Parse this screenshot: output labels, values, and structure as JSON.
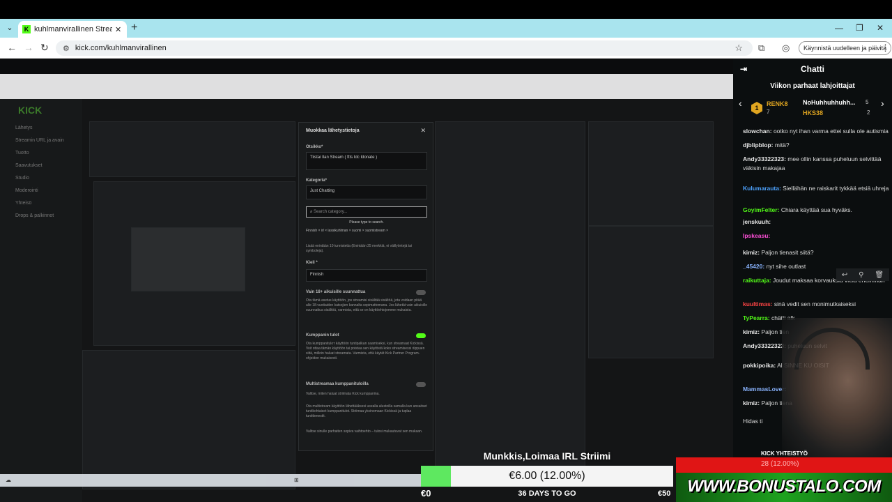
{
  "browser": {
    "tab_title": "kuhlmanvirallinen Stream - Wa",
    "url": "kick.com/kuhlmanvirallinen",
    "restart_label": "Käynnistä uudelleen ja päivitä"
  },
  "modal": {
    "title": "Muokkaa lähetystietoja",
    "title_label": "Otsikko*",
    "title_value": "Tiistai Ilan Stream ( ftts Idc Idonate )",
    "category_label": "Kategoria*",
    "category_value": "Just Chatting",
    "search_placeholder": "Search category...",
    "search_hint": "Please type to search.",
    "tags": [
      "Finnish ×",
      "irl ×",
      "lassikuhlman ×",
      "suomi ×",
      "suomistream ×"
    ],
    "tags_hint": "Lisää enintään 10 tunnistetta (Enintään 25 merkkiä, ei välilyöntejä tai symboleja).",
    "language_label": "Kieli *",
    "language_value": "Finnish",
    "adult_label": "Vain 18+ aikuisille suunnattua",
    "adult_text": "Ota tämä asetus käyttöön, jos streamisi sisältää sisältöä, jota voidaan pitää alle 18-vuotiaiden katsojien kannalta sopimattomana. Jos lähetät vain aikuisille suunnattua sisältöä, varmista, että se on käyttöehtojemme mukaista.",
    "partner_label": "Kumppanin tulot",
    "partner_text": "Ota kumppanituloт käyttöön tuntipalkan saamiseksi, kun streamaat Kickissä. Voit ottaa tämän käyttöön tai poistaa sen käytöstä koko streamisessi riippuen siitä, milloin haluat streamata. Varmista, että käytät Kick Partner Program-ohjeiden mukaisesti.",
    "multi_label": "Multistreamaa kumppanituloilla",
    "multi_text": "Valitse, miten haluat striimata Kick kumppanina.",
    "multi_text2": "Ota multistream käyttöön lähettääksesi usealla alustoilla samalla kun ansaitset tuntikohtaiset kumppanitulot. Striimaa yksinomaan Kickissä ja tuplaa tuntitienestit.",
    "multi_text3": "Valitse sinulle parhaiten sopiva vaihtoehto – tulosi mukautuvat sen mukaan."
  },
  "chat": {
    "header": "Chatti",
    "top_gifters_label": "Viikon parhaat lahjoittajat",
    "gifters": [
      {
        "name": "RENK8",
        "count": "7"
      },
      {
        "name": "NoHuhhuhhuhh...",
        "count": "5"
      },
      {
        "name": "HKS38",
        "count": "2"
      }
    ],
    "messages": [
      {
        "user": "slowchan:",
        "text": "ootko nyt ihan varma ettei sulla ole autismia",
        "color": "#e6e6e6"
      },
      {
        "user": "djblipblop:",
        "text": "mitä?",
        "color": "#e6e6e6"
      },
      {
        "user": "Andy33322323:",
        "text": "mee ollin kanssa puheluun selvittää väkisin makajaa",
        "color": "#e6e6e6"
      },
      {
        "user": "Kulumarauta:",
        "text": "Siellähän ne raiskarit tykkää etsiä uhreja",
        "color": "#4da3ff"
      },
      {
        "user": "GoyimFelter:",
        "text": "Chiara käyttää sua hyväks.",
        "color": "#53fc18"
      },
      {
        "user": "jenskuuh:",
        "text": "",
        "color": "#e6e6e6"
      },
      {
        "user": "Ipskeasu:",
        "text": "",
        "color": "#ff4fd8"
      },
      {
        "user": "kimiz:",
        "text": "Paljon tienasit siitä?",
        "color": "#e6e6e6"
      },
      {
        "user": "_45420:",
        "text": "nyt sihe outlast",
        "color": "#8ab4ff"
      },
      {
        "user": "raikuttaja:",
        "text": "Joudut maksaa korvauksia vielä enemmän",
        "color": "#53fc18"
      },
      {
        "user": "kuultimas:",
        "text": "sinä vedit sen monimutkaiseksi",
        "color": "#ff4444"
      },
      {
        "user": "TyPearra:",
        "text": "chätti alk",
        "color": "#53fc18"
      },
      {
        "user": "kimiz:",
        "text": "Paljon tien",
        "color": "#e6e6e6"
      },
      {
        "user": "Andy33322323:",
        "text": "puheluun selvit",
        "color": "#e6e6e6"
      },
      {
        "user": "pokkipoika:",
        "text": "Al SINNE KU OISIT",
        "color": "#e6e6e6"
      },
      {
        "user": "MammasLover:",
        "text": "",
        "color": "#8ab4ff"
      },
      {
        "user": "kimiz:",
        "text": "Paljon tiena",
        "color": "#e6e6e6"
      },
      {
        "user": "",
        "text": "Hidas ti",
        "color": "#aaaaaa"
      }
    ]
  },
  "overlay": {
    "title": "Munkkis,Loimaa IRL Striimi",
    "amount": "€6.00 (12.00%)",
    "progress": 0.12,
    "goal_low": "€0",
    "days_to_go": "36 DAYS TO GO",
    "goal_high": "€50",
    "kick_label": "KICK YHTEISTYÖ",
    "kick_sub": "28 (12.00%)",
    "bonus_text": "WWW.BONUSTALO.COM"
  }
}
